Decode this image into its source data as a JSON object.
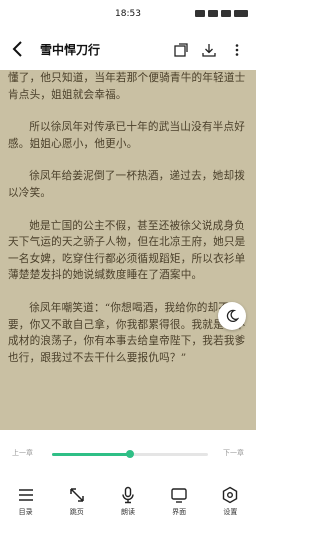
{
  "status": {
    "time": "18:53"
  },
  "header": {
    "title": "雪中悍刀行",
    "back_icon": "back-arrow-icon",
    "icons": [
      "sync-icon",
      "download-icon",
      "more-icon"
    ]
  },
  "content": {
    "paragraphs": [
      "懂了，他只知道，当年若那个便骑青牛的年轻道士肯点头，姐姐就会幸福。",
      "所以徐凤年对传承已十年的武当山没有半点好感。姐姐心愿小，他更小。",
      "徐凤年给姜泥倒了一杯热酒，递过去，她却拨以冷笑。",
      "她是亡国的公主不假，甚至还被徐父说成身负天下气运的天之骄子人物，但在北凉王府，她只是一名女婢，吃穿住行都必须循规蹈矩，所以衣衫单薄楚楚发抖的她说缄数度睡在了酒案中。",
      "徐凤年嘲笑道：“你想喝酒，我给你的却不要，你又不敢自己拿，你我都累得很。我就是个不成材的浪荡子，你有本事去给皇帝陛下，我若我爹也行，跟我过不去干什么要报仇吗？”"
    ]
  },
  "night_toggle": {
    "icon": "moon-icon"
  },
  "progress": {
    "prev_label": "上一章",
    "next_label": "下一章",
    "value": 0.5
  },
  "toolbar": {
    "items": [
      {
        "label": "目录",
        "icon": "catalog-icon"
      },
      {
        "label": "跳页",
        "icon": "expand-icon"
      },
      {
        "label": "朗读",
        "icon": "microphone-icon"
      },
      {
        "label": "界面",
        "icon": "display-icon"
      },
      {
        "label": "设置",
        "icon": "settings-icon"
      }
    ]
  },
  "colors": {
    "page_bg": "#c9c0a3",
    "text": "#4a3f2a",
    "accent": "#2fbf86"
  }
}
